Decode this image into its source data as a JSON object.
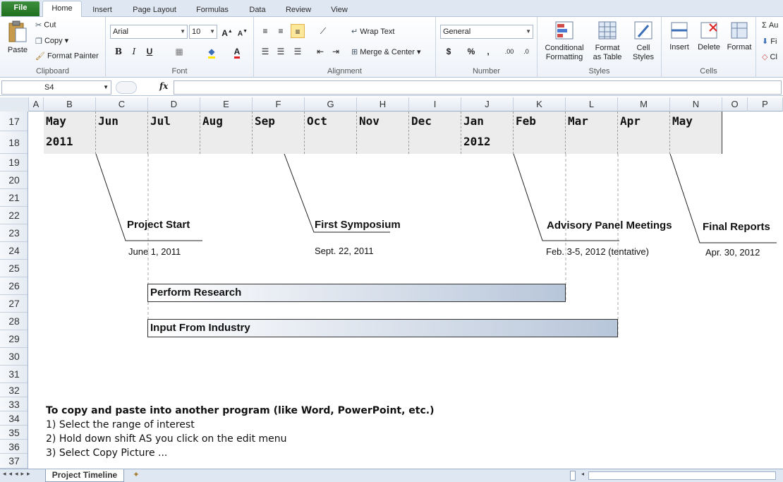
{
  "ribbon_tabs": {
    "file": "File",
    "home": "Home",
    "insert": "Insert",
    "page_layout": "Page Layout",
    "formulas": "Formulas",
    "data": "Data",
    "review": "Review",
    "view": "View"
  },
  "clipboard": {
    "paste": "Paste",
    "cut": "Cut",
    "copy": "Copy",
    "format_painter": "Format Painter",
    "label": "Clipboard"
  },
  "font": {
    "name": "Arial",
    "size": "10",
    "bold": "B",
    "italic": "I",
    "underline": "U",
    "label": "Font"
  },
  "alignment": {
    "wrap_text": "Wrap Text",
    "merge_center": "Merge & Center",
    "label": "Alignment"
  },
  "number": {
    "format": "General",
    "currency": "$",
    "percent": "%",
    "comma": ",",
    "label": "Number"
  },
  "styles": {
    "conditional": "Conditional",
    "conditional2": "Formatting",
    "format_table": "Format",
    "format_table2": "as Table",
    "cell_styles": "Cell",
    "cell_styles2": "Styles",
    "label": "Styles"
  },
  "cells": {
    "insert": "Insert",
    "delete": "Delete",
    "format": "Format",
    "label": "Cells"
  },
  "editing": {
    "autosum": "Au",
    "fill": "Fi",
    "clear": "Cl"
  },
  "formula_bar": {
    "name_box": "S4",
    "fx": "fx",
    "value": ""
  },
  "columns": [
    "A",
    "B",
    "C",
    "D",
    "E",
    "F",
    "G",
    "H",
    "I",
    "J",
    "K",
    "L",
    "M",
    "N",
    "O",
    "P"
  ],
  "rows": [
    "17",
    "18",
    "19",
    "20",
    "21",
    "22",
    "23",
    "24",
    "25",
    "26",
    "27",
    "28",
    "29",
    "30",
    "31",
    "32",
    "33",
    "34",
    "35",
    "36",
    "37"
  ],
  "timeline": {
    "months": [
      "May",
      "Jun",
      "Jul",
      "Aug",
      "Sep",
      "Oct",
      "Nov",
      "Dec",
      "Jan",
      "Feb",
      "Mar",
      "Apr",
      "May"
    ],
    "year_2011": "2011",
    "year_2012": "2012"
  },
  "milestones": [
    {
      "label": "Project Start",
      "date": "June 1, 2011"
    },
    {
      "label": "First Symposium",
      "date": "Sept. 22, 2011"
    },
    {
      "label": "Advisory  Panel Meetings",
      "date": "Feb. 3-5, 2012  (tentative)"
    },
    {
      "label": "Final Reports",
      "date": "Apr. 30, 2012"
    }
  ],
  "tasks": [
    {
      "label": "Perform Research"
    },
    {
      "label": "Input From Industry"
    }
  ],
  "notes": [
    "To copy and paste into another program (like Word, PowerPoint, etc.)",
    "1) Select the range of interest",
    "2) Hold down shift AS you click on the edit menu",
    "3) Select Copy Picture ..."
  ],
  "sheet_tab": "Project Timeline"
}
